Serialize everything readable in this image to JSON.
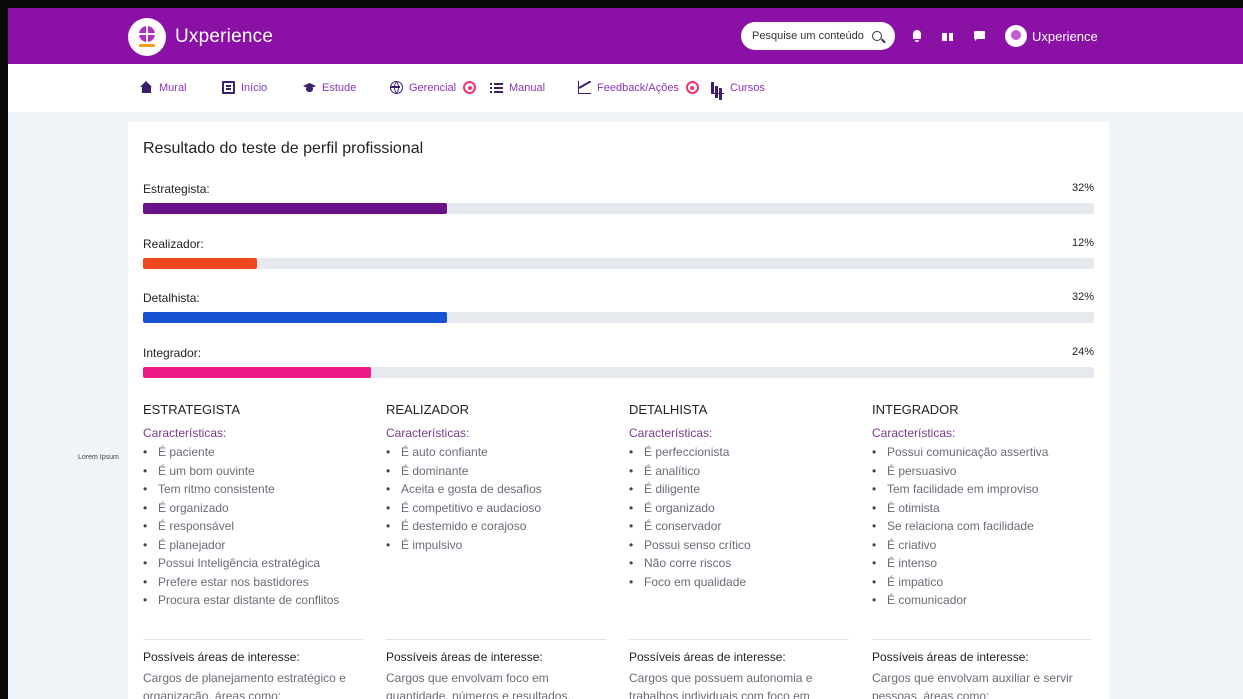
{
  "app": {
    "name": "Uxperience",
    "user_name": "Uxperience"
  },
  "search": {
    "placeholder": "Pesquise um conteúdo"
  },
  "nav": {
    "items": [
      {
        "label": "Mural",
        "icon": "home-icon"
      },
      {
        "label": "Início",
        "icon": "book-icon"
      },
      {
        "label": "Estude",
        "icon": "graduation-cap-icon"
      },
      {
        "label": "Gerencial",
        "icon": "globe-icon",
        "badge": true
      },
      {
        "label": "Manual",
        "icon": "list-icon"
      },
      {
        "label": "Feedback/Ações",
        "icon": "line-chart-icon",
        "badge": true
      },
      {
        "label": "Cursos",
        "icon": "bar-chart-icon"
      }
    ]
  },
  "side_label": "Lorem Ipsum",
  "result": {
    "title": "Resultado do teste de perfil profissional",
    "bars": [
      {
        "label": "Estrategista:",
        "percent": 32,
        "percent_text": "32%",
        "color": "#6a1089"
      },
      {
        "label": "Realizador:",
        "percent": 12,
        "percent_text": "12%",
        "color": "#f1471c"
      },
      {
        "label": "Detalhista:",
        "percent": 32,
        "percent_text": "32%",
        "color": "#1752d3"
      },
      {
        "label": "Integrador:",
        "percent": 24,
        "percent_text": "24%",
        "color": "#ef1a8a"
      }
    ]
  },
  "profiles": [
    {
      "name": "ESTRATEGISTA",
      "traits_title": "Características:",
      "traits": [
        "É paciente",
        "É um bom ouvinte",
        "Tem ritmo consistente",
        "É organizado",
        "É responsável",
        "É planejador",
        "Possui Inteligência estratégica",
        "Prefere estar nos bastidores",
        "Procura estar distante de conflitos"
      ],
      "areas_title": "Possíveis áreas de interesse:",
      "areas_text": "Cargos de planejamento estratégico e organização, áreas como:"
    },
    {
      "name": "REALIZADOR",
      "traits_title": "Características:",
      "traits": [
        "É auto confiante",
        "É dominante",
        "Aceita e gosta de desafios",
        "É competitivo e audacioso",
        "É destemido e corajoso",
        "É impulsivo"
      ],
      "areas_title": "Possíveis áreas de interesse:",
      "areas_text": "Cargos que envolvam foco em quantidade, números e resultados."
    },
    {
      "name": "DETALHISTA",
      "traits_title": "Características:",
      "traits": [
        "É perfeccionista",
        "É analítico",
        "É diligente",
        "É organizado",
        "É conservador",
        "Possui senso crítico",
        "Não corre riscos",
        "Foco em qualidade"
      ],
      "areas_title": "Possíveis áreas de interesse:",
      "areas_text": "Cargos que possuem autonomia e trabalhos individuais com foco em"
    },
    {
      "name": "INTEGRADOR",
      "traits_title": "Características:",
      "traits": [
        "Possui comunicação assertiva",
        "É persuasivo",
        "Tem facilidade em improviso",
        "É otimista",
        "Se relaciona com facilidade",
        "É criativo",
        "É intenso",
        "É impatico",
        "É comunicador"
      ],
      "areas_title": "Possíveis áreas de interesse:",
      "areas_text": "Cargos que envolvam auxiliar e servir pessoas, áreas como:"
    }
  ]
}
